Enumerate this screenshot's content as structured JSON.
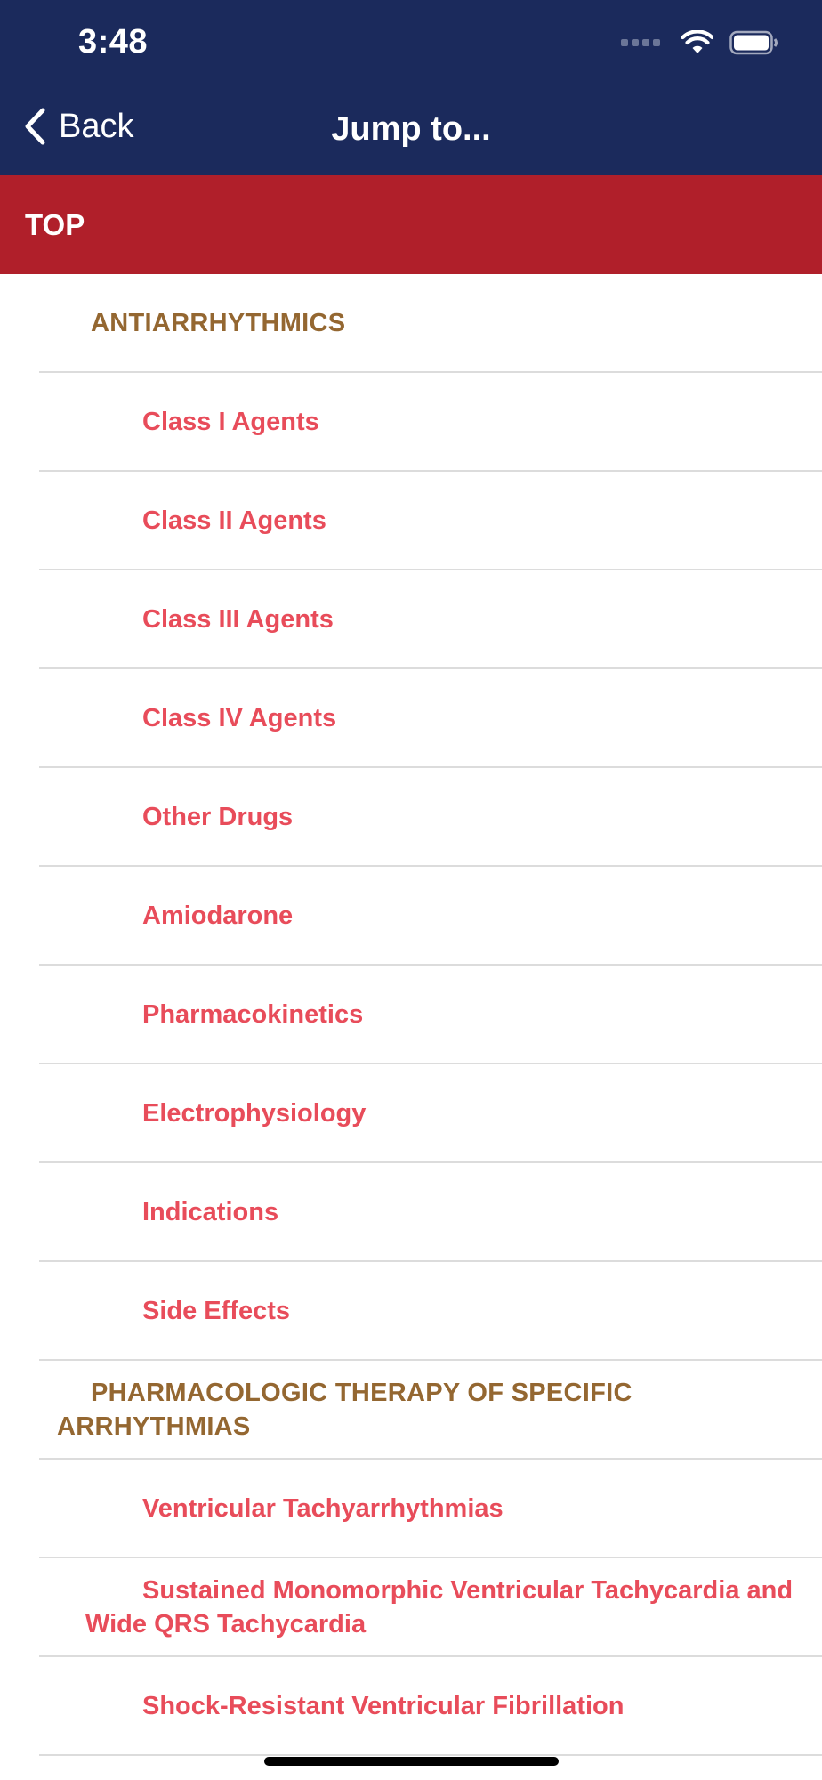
{
  "status_bar": {
    "time": "3:48",
    "icons": [
      "signal-dots-icon",
      "wifi-icon",
      "battery-icon"
    ]
  },
  "nav": {
    "back_label": "Back",
    "title": "Jump to..."
  },
  "top_label": "TOP",
  "colors": {
    "nav_background": "#1b2a5c",
    "top_bar_background": "#b01f2a",
    "section_text": "#946731",
    "item_text": "#e84c5a"
  },
  "rows": [
    {
      "type": "section",
      "label": "ANTIARRHYTHMICS"
    },
    {
      "type": "item",
      "label": "Class I Agents"
    },
    {
      "type": "item",
      "label": "Class II Agents"
    },
    {
      "type": "item",
      "label": "Class III Agents"
    },
    {
      "type": "item",
      "label": "Class IV Agents"
    },
    {
      "type": "item",
      "label": "Other Drugs"
    },
    {
      "type": "item",
      "label": "Amiodarone"
    },
    {
      "type": "item",
      "label": "Pharmacokinetics"
    },
    {
      "type": "item",
      "label": "Electrophysiology"
    },
    {
      "type": "item",
      "label": "Indications"
    },
    {
      "type": "item",
      "label": "Side Effects"
    },
    {
      "type": "section",
      "label": "PHARMACOLOGIC THERAPY OF SPECIFIC ARRHYTHMIAS"
    },
    {
      "type": "item",
      "label": "Ventricular Tachyarrhythmias"
    },
    {
      "type": "item",
      "label": "Sustained Monomorphic Ventricular Tachycardia and Wide QRS Tachycardia"
    },
    {
      "type": "item",
      "label": "Shock-Resistant Ventricular Fibrillation"
    }
  ]
}
